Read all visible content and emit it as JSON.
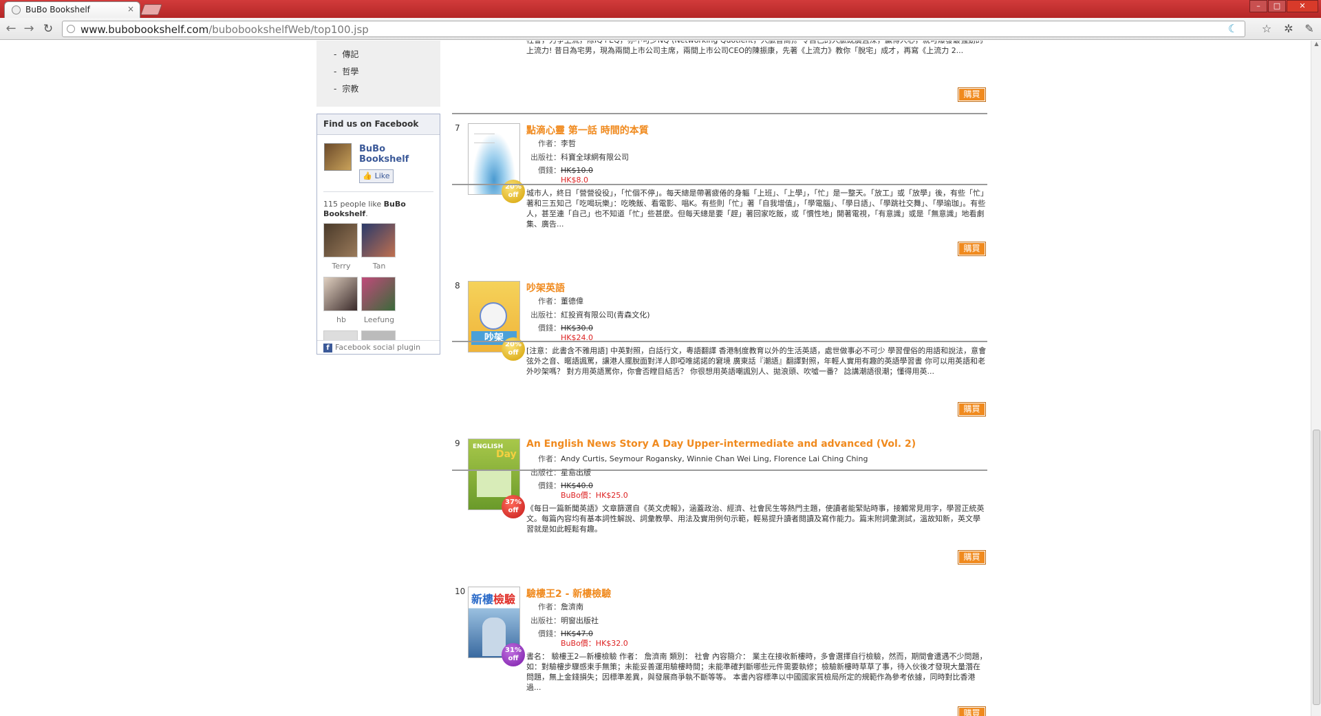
{
  "browser": {
    "tab_title": "BuBo Bookshelf",
    "tab_close": "×",
    "url_host": "www.bubobookshelf.com",
    "url_path": "/bubobookshelfWeb/top100.jsp"
  },
  "sidebar": {
    "categories": [
      "傳記",
      "哲學",
      "宗教"
    ],
    "facebook": {
      "header": "Find us on Facebook",
      "page_name": "BuBo Bookshelf",
      "like_label": "Like",
      "likes_prefix": "115 people like ",
      "likes_name": "BuBo Bookshelf",
      "likes_suffix": ".",
      "fans": [
        "Terry",
        "Tan",
        "hb",
        "Leefung"
      ],
      "footer": "Facebook social plugin"
    }
  },
  "colors": {
    "accent": "#f08a1e",
    "price_sale": "#dd2222",
    "fb_blue": "#3b5998"
  },
  "top_fragment": {
    "desc": "社會，力爭上流，除IQ+EQ，亦不可少NQ (Networking Quotient，人脈智商)。令自己的人脈既廣且深，贏得人心，就可爆發最強勁的上流力! 昔日為宅男，現為兩間上市公司主席，兩間上市公司CEO的陳振康，先著《上流力》教你「脫宅」成才，再寫《上流力 2...",
    "buy": "購買"
  },
  "labels": {
    "author": "作者：",
    "publisher": "出版社：",
    "price": "價錢：",
    "buy": "購買"
  },
  "items": [
    {
      "rank": "7",
      "title": "點滴心靈 第一話 時間的本質",
      "author": "李哲",
      "publisher": "科寶全球網有限公司",
      "orig_price": "HK$10.0",
      "sale_price": "HK$8.0",
      "discount": "20%",
      "discount_sub": "off",
      "desc": "城市人，終日「營營役役」，「忙個不停」。每天總是帶著疲倦的身軀「上班」、「上學」，「忙」是一整天。「放工」或「放學」後，有些「忙」著和三五知己「吃喝玩樂」：吃晚飯、看電影、唱K。有些則「忙」著「自我增值」，「學電腦」、「學日語」、「學跳社交舞」、「學瑜珈」。有些人，甚至連「自己」也不知道「忙」些甚麼。但每天總是要「趕」著回家吃飯，或「慣性地」開著電視，「有意識」或是「無意識」地看劇集、廣告..."
    },
    {
      "rank": "8",
      "title": "吵架英語",
      "author": "董德偉",
      "publisher": "紅投資有限公司(青森文化)",
      "orig_price": "HK$30.0",
      "sale_price": "HK$24.0",
      "discount": "20%",
      "discount_sub": "off",
      "desc": "[注意：此書含不雅用語] 中英對照，白話行文，粵語翻譯 香港制度教育以外的生活英語，處世做事必不可少 學習俚俗的用語和說法，意會弦外之音、暱語諷罵，讓港人擺脫面對洋人即啞唯諾諾的窘境 廣東話『潮語』翻譯對照，年輕人實用有趣的英語學習書 你可以用英語和老外吵架嗎？ 對方用英語罵你，你會否瞠目結舌？ 你很想用英語嘲諷別人、拋浪頭、吹噓一番？ 諗講潮語很潮；懂得用英..."
    },
    {
      "rank": "9",
      "title": "An English News Story A Day Upper-intermediate and advanced (Vol. 2)",
      "author": "Andy Curtis, Seymour Rogansky, Winnie Chan Wei Ling, Florence Lai Ching Ching",
      "publisher": "星島出版",
      "orig_price": "HK$40.0",
      "sale_price": "BuBo價：HK$25.0",
      "discount": "37%",
      "discount_sub": "off",
      "desc": "《每日一篇新聞英語》文章篩選自《英文虎報》，涵蓋政治、經濟、社會民生等熱門主題，使讀者能緊貼時事，接觸常見用字，學習正統英文。每篇內容均有基本詞性解說、詞彙教學、用法及實用例句示範，輕易提升讀者閱讀及寫作能力。篇末附詞彙測試，溫故知新，英文學習就是如此輕鬆有趣。"
    },
    {
      "rank": "10",
      "title": "驗樓王2 - 新樓檢驗",
      "author": "詹濟南",
      "publisher": "明窗出版社",
      "orig_price": "HK$47.0",
      "sale_price": "BuBo價：HK$32.0",
      "discount": "31%",
      "discount_sub": "off",
      "desc": "書名： 驗樓王2—新樓檢驗 作者： 詹濟南 類別： 社會 內容簡介： 業主在接收新樓時，多會選擇自行檢驗，然而，期間會遭遇不少問題，如：對驗樓步驟感束手無策；未能妥善運用驗樓時間；未能準確判斷哪些元件需要執修；檢驗新樓時草草了事，待入伙後才發現大量潛在問題，無上金錢損失；因標準差異，與發展商爭執不斷等等。 本書內容標準以中國國家質檢局所定的規範作為參考依據，同時對比香港過..."
    }
  ]
}
